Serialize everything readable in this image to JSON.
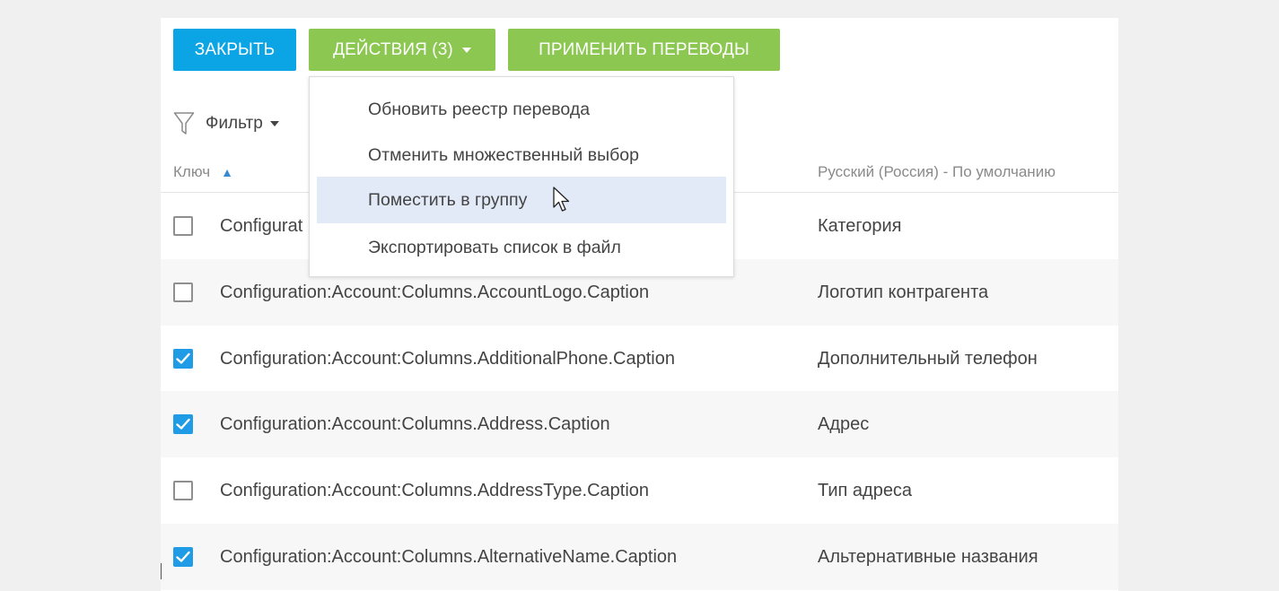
{
  "toolbar": {
    "close_label": "ЗАКРЫТЬ",
    "actions_label": "ДЕЙСТВИЯ (3)",
    "apply_label": "ПРИМЕНИТЬ ПЕРЕВОДЫ"
  },
  "filter": {
    "label": "Фильтр"
  },
  "columns": {
    "key": "Ключ",
    "ru": "Русский (Россия) - По умолчанию"
  },
  "actions_menu": {
    "items": [
      {
        "label": "Обновить реестр перевода",
        "hovered": false
      },
      {
        "label": "Отменить множественный выбор",
        "hovered": false
      },
      {
        "label": "Поместить в группу",
        "hovered": true
      },
      {
        "label": "Экспортировать список в файл",
        "hovered": false
      }
    ]
  },
  "rows": [
    {
      "key": "Configuration:Account:Columns.AccountCategory.Caption",
      "key_visible": "Configurat",
      "ru": "Категория",
      "checked": false
    },
    {
      "key": "Configuration:Account:Columns.AccountLogo.Caption",
      "ru": "Логотип контрагента",
      "checked": false
    },
    {
      "key": "Configuration:Account:Columns.AdditionalPhone.Caption",
      "ru": "Дополнительный телефон",
      "checked": true
    },
    {
      "key": "Configuration:Account:Columns.Address.Caption",
      "ru": "Адрес",
      "checked": true
    },
    {
      "key": "Configuration:Account:Columns.AddressType.Caption",
      "ru": "Тип адреса",
      "checked": false
    },
    {
      "key": "Configuration:Account:Columns.AlternativeName.Caption",
      "ru": "Альтернативные названия",
      "checked": true
    }
  ],
  "colors": {
    "primary": "#0ba5e6",
    "green": "#8bc751",
    "checkbox_checked": "#1f9ce5",
    "menu_hover": "#e2e9f7"
  }
}
